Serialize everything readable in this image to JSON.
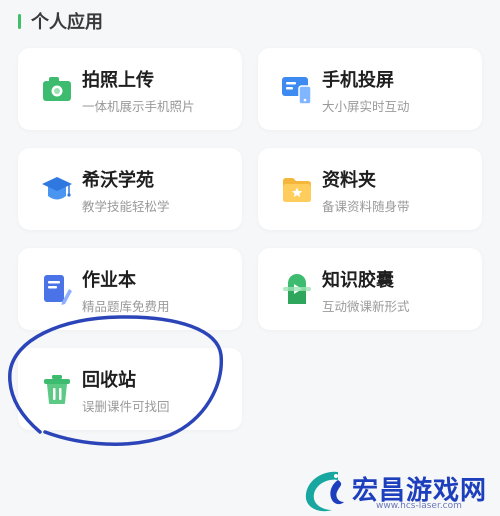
{
  "section": {
    "title": "个人应用"
  },
  "apps": [
    {
      "name": "拍照上传",
      "desc": "一体机展示手机照片",
      "icon": "camera-icon"
    },
    {
      "name": "手机投屏",
      "desc": "大小屏实时互动",
      "icon": "screen-cast-icon"
    },
    {
      "name": "希沃学苑",
      "desc": "教学技能轻松学",
      "icon": "graduation-cap-icon"
    },
    {
      "name": "资料夹",
      "desc": "备课资料随身带",
      "icon": "folder-icon"
    },
    {
      "name": "作业本",
      "desc": "精品题库免费用",
      "icon": "homework-book-icon"
    },
    {
      "name": "知识胶囊",
      "desc": "互动微课新形式",
      "icon": "capsule-play-icon"
    },
    {
      "name": "回收站",
      "desc": "误删课件可找回",
      "icon": "trash-bin-icon"
    }
  ],
  "watermark": {
    "text": "宏昌游戏网",
    "url": "www.hcs-laser.com"
  },
  "colors": {
    "accent": "#3fbf6a",
    "annotation": "#2b45b8",
    "watermark": "#1d3fbd"
  }
}
